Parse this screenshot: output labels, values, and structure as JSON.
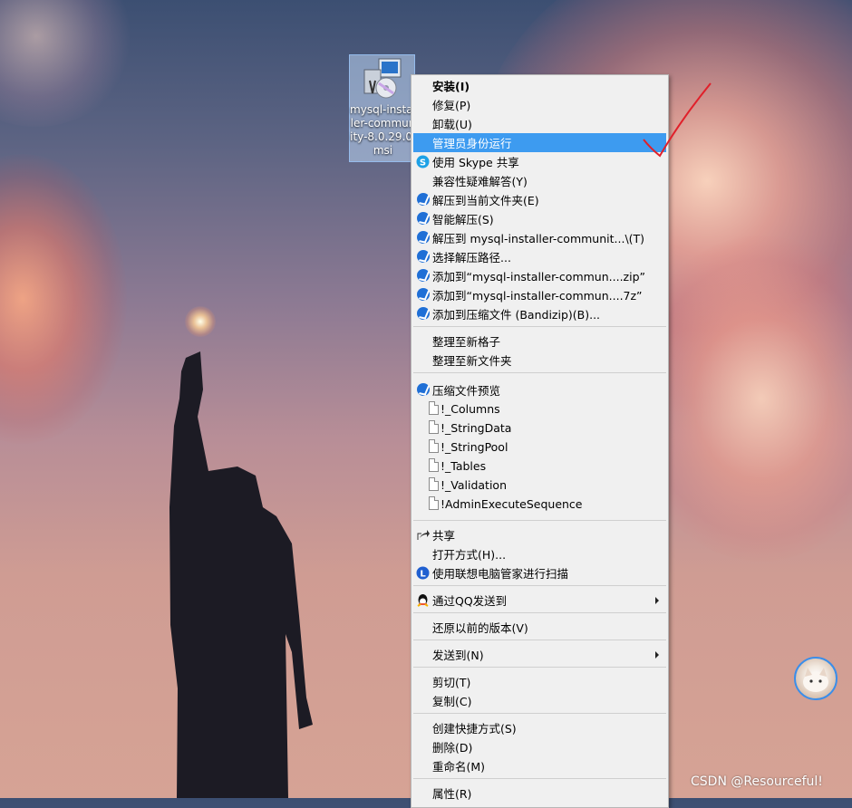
{
  "desktop_icon": {
    "label": "mysql-installer-community-8.0.29.0.msi"
  },
  "context_menu": {
    "items": [
      {
        "id": "install",
        "label": "安装(I)",
        "bold": true
      },
      {
        "id": "repair",
        "label": "修复(P)"
      },
      {
        "id": "uninstall",
        "label": "卸载(U)"
      },
      {
        "id": "run-as-admin",
        "label": "管理员身份运行",
        "highlighted": true
      },
      {
        "id": "share-skype",
        "label": "使用 Skype 共享",
        "icon": "skype-icon"
      },
      {
        "id": "compat-troubleshoot",
        "label": "兼容性疑难解答(Y)"
      },
      {
        "id": "extract-here",
        "label": "解压到当前文件夹(E)",
        "icon": "bandizip-icon"
      },
      {
        "id": "smart-extract",
        "label": "智能解压(S)",
        "icon": "bandizip-icon"
      },
      {
        "id": "extract-to-folder",
        "label": "解压到 mysql-installer-communit...\\(T)",
        "icon": "bandizip-icon"
      },
      {
        "id": "choose-extract-path",
        "label": "选择解压路径...",
        "icon": "bandizip-icon"
      },
      {
        "id": "add-to-zip",
        "label": "添加到“mysql-installer-commun....zip”",
        "icon": "bandizip-icon"
      },
      {
        "id": "add-to-7z",
        "label": "添加到“mysql-installer-commun....7z”",
        "icon": "bandizip-icon"
      },
      {
        "id": "add-to-archive",
        "label": "添加到压缩文件 (Bandizip)(B)...",
        "icon": "bandizip-icon"
      },
      {
        "id": "organize-new-grid",
        "label": "整理至新格子"
      },
      {
        "id": "organize-new-folder",
        "label": "整理至新文件夹"
      },
      {
        "id": "archive-preview",
        "label": "压缩文件预览",
        "icon": "bandizip-icon"
      },
      {
        "id": "preview-columns",
        "label": "!_Columns",
        "icon": "file-icon"
      },
      {
        "id": "preview-stringdata",
        "label": "!_StringData",
        "icon": "file-icon"
      },
      {
        "id": "preview-stringpool",
        "label": "!_StringPool",
        "icon": "file-icon"
      },
      {
        "id": "preview-tables",
        "label": "!_Tables",
        "icon": "file-icon"
      },
      {
        "id": "preview-validation",
        "label": "!_Validation",
        "icon": "file-icon"
      },
      {
        "id": "preview-adminexecute",
        "label": "!AdminExecuteSequence",
        "icon": "file-icon"
      },
      {
        "id": "share",
        "label": "共享",
        "icon": "share-icon"
      },
      {
        "id": "open-with",
        "label": "打开方式(H)..."
      },
      {
        "id": "lenovo-scan",
        "label": "使用联想电脑管家进行扫描",
        "icon": "lenovo-icon"
      },
      {
        "id": "send-via-qq",
        "label": "通过QQ发送到",
        "icon": "qq-icon",
        "submenu": true
      },
      {
        "id": "restore-previous",
        "label": "还原以前的版本(V)"
      },
      {
        "id": "send-to",
        "label": "发送到(N)",
        "submenu": true
      },
      {
        "id": "cut",
        "label": "剪切(T)"
      },
      {
        "id": "copy",
        "label": "复制(C)"
      },
      {
        "id": "create-shortcut",
        "label": "创建快捷方式(S)"
      },
      {
        "id": "delete",
        "label": "删除(D)"
      },
      {
        "id": "rename",
        "label": "重命名(M)"
      },
      {
        "id": "properties",
        "label": "属性(R)"
      }
    ]
  },
  "watermark": "CSDN @Resourceful!",
  "colors": {
    "highlight": "#3d9bf0",
    "menu_bg": "#f0f0f0",
    "annotation_check": "#e0202a"
  }
}
